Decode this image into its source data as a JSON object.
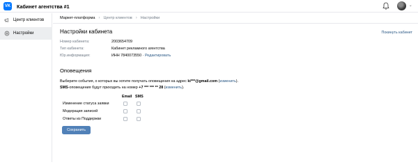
{
  "header": {
    "logo_text": "VK",
    "title": "Кабинет агентства #1",
    "title_chevron": "⌄",
    "avatar_chevron": "⌄"
  },
  "sidebar": {
    "items": [
      {
        "label": "Центр клиентов",
        "icon": "megaphone-icon"
      },
      {
        "label": "Настройки",
        "icon": "settings-gear-icon",
        "active": true
      }
    ]
  },
  "breadcrumb": {
    "items": [
      "Маркет-платформа",
      "Центр клиентов",
      "Настройки"
    ],
    "separator": "›"
  },
  "cabinet_settings": {
    "title": "Настройки кабинета",
    "close_link": "Покинуть кабинет",
    "rows": [
      {
        "key": "Номер кабинета:",
        "value": "2003654709"
      },
      {
        "key": "Тип кабинета:",
        "value": "Кабинет рекламного агентства"
      },
      {
        "key": "Юр.информация:",
        "value": "ИНН 7840073550",
        "separator": " · ",
        "link": "Редактировать"
      }
    ]
  },
  "notifications": {
    "title": "Оповещения",
    "line1_prefix": "Выберите события, о которых вы хотите получать оповещения на адрес ",
    "email": "ki***@gmail.com",
    "change_open": " (",
    "change_link": "изменить",
    "line1_suffix": ").",
    "line2_sms": "SMS",
    "line2_prefix": "-оповещения будут приходить на номер ",
    "phone": "+7 *** *** ** 28",
    "line2_suffix": ").",
    "columns": [
      "Email",
      "SMS"
    ],
    "events": [
      {
        "label": "Изменение статуса заявки",
        "email": false,
        "sms": false
      },
      {
        "label": "Модерация записей",
        "email": false,
        "sms": false
      },
      {
        "label": "Ответы из Поддержки",
        "email": false,
        "sms": false
      }
    ],
    "save_label": "Сохранить"
  },
  "colors": {
    "brand": "#0077ff",
    "link": "#2a5885",
    "button": "#5181b8",
    "active_sidebar": "#eceef0"
  }
}
